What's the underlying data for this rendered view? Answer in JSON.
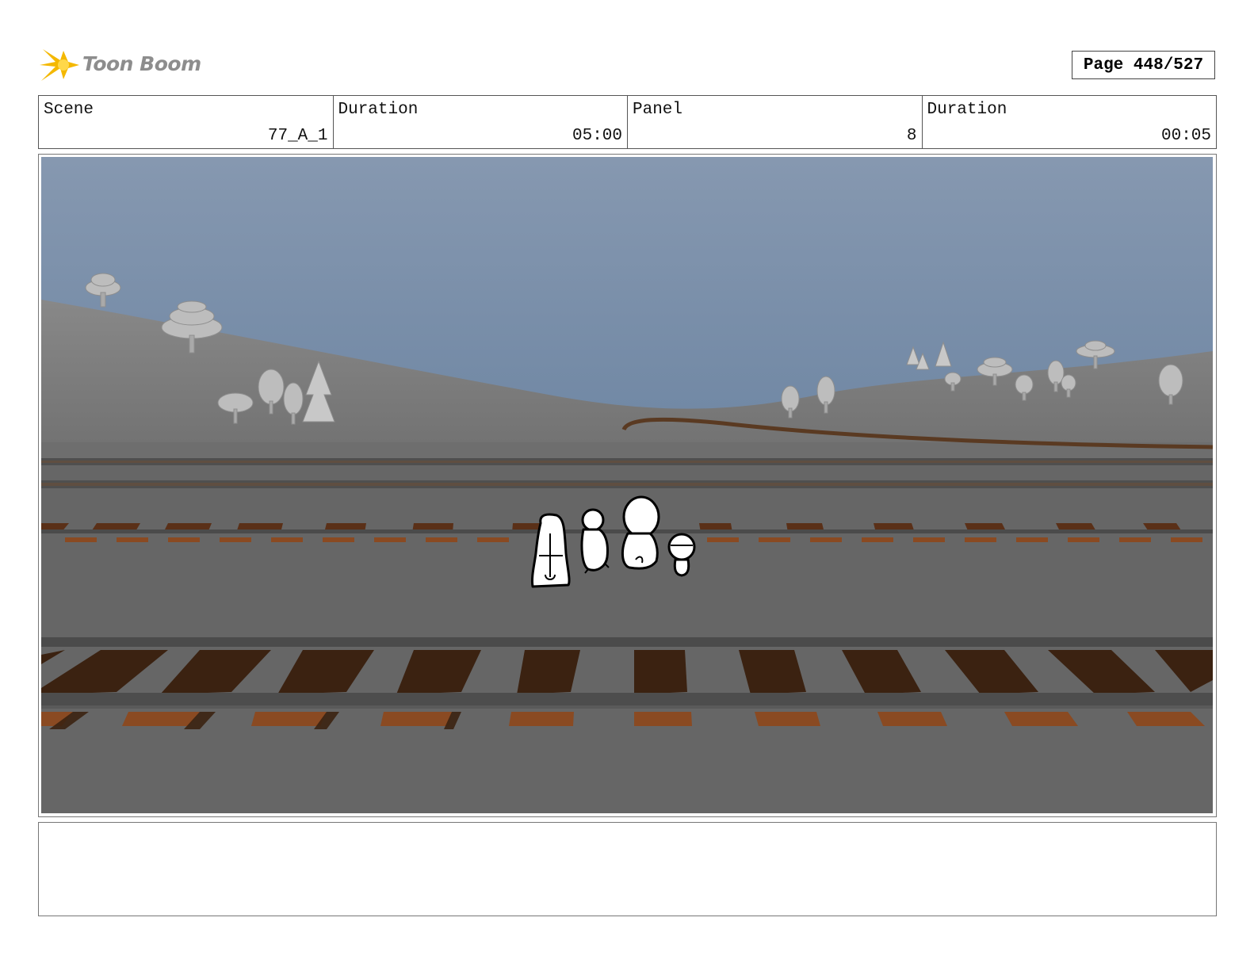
{
  "brand": {
    "name": "Toon Boom",
    "logo_icon": "starburst-icon",
    "colors": {
      "logo_star": "#f4b800",
      "logo_text": "#8d8d8d"
    }
  },
  "page_indicator": "Page 448/527",
  "info_table": [
    {
      "label": "Scene",
      "value": "77_A_1"
    },
    {
      "label": "Duration",
      "value": "05:00"
    },
    {
      "label": "Panel",
      "value": "8"
    },
    {
      "label": "Duration",
      "value": "00:05"
    }
  ],
  "panel": {
    "scene_colors": {
      "sky_top": "#8698b0",
      "sky_bottom": "#7188a3",
      "ground": "#666666",
      "hill": "#7a7a7a",
      "rail": "#4d4d4d",
      "tie": "#3b2211",
      "tie_highlight": "#8a4a22"
    },
    "characters_drawn": 4
  },
  "notes": ""
}
